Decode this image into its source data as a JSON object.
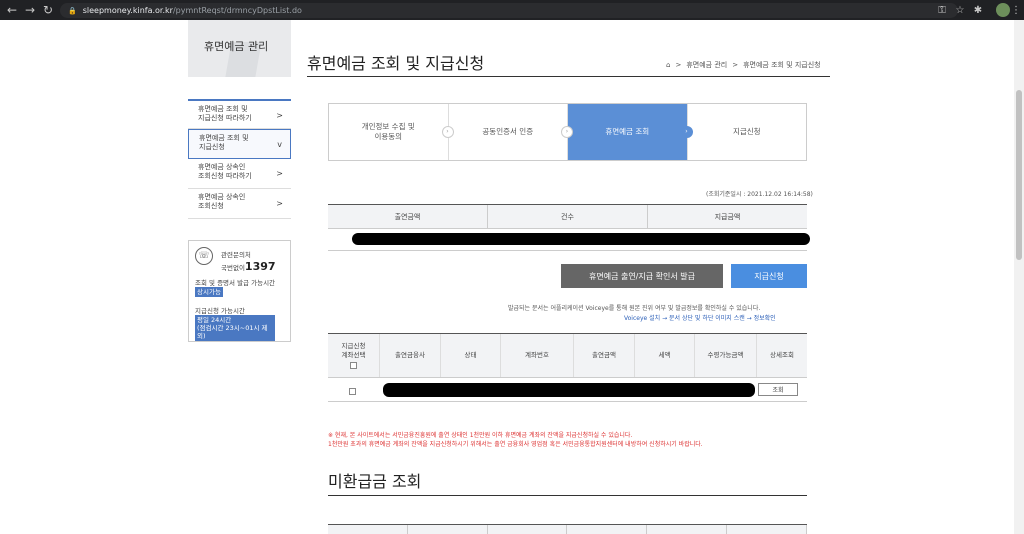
{
  "browser": {
    "url_host": "sleepmoney.kinfa.or.kr",
    "url_path": "/pymntReqst/drmncyDpstList.do"
  },
  "sidebar": {
    "title": "휴면예금 관리",
    "items": [
      {
        "line1": "휴면예금 조회 및",
        "line2": "지급신청 따라하기",
        "arrow": ">"
      },
      {
        "line1": "휴면예금 조회 및",
        "line2": "지급신청",
        "arrow": "v"
      },
      {
        "line1": "휴면예금 상속인",
        "line2": "조회신청 따라하기",
        "arrow": ">"
      },
      {
        "line1": "휴면예금 상속인",
        "line2": "조회신청",
        "arrow": ">"
      }
    ],
    "contact": {
      "label": "관련문의처",
      "number_prefix": "국번없이",
      "number": "1397",
      "hours_label": "조회 및 증명서 발급 가능시간",
      "hours_badge": "상시가능",
      "apply_label": "지급신청 가능시간",
      "apply_badge1": "평일 24시간",
      "apply_badge2": "(점검시간 23시~01시 제외)"
    }
  },
  "main": {
    "title": "휴면예금 조회 및 지급신청",
    "breadcrumb": [
      ">",
      "휴면예금 관리",
      ">",
      "휴면예금 조회 및 지급신청"
    ],
    "steps": [
      {
        "line1": "개인정보 수집 및",
        "line2": "이용동의"
      },
      {
        "line1": "공동인증서 인증",
        "line2": ""
      },
      {
        "line1": "휴면예금 조회",
        "line2": ""
      },
      {
        "line1": "지급신청",
        "line2": ""
      }
    ],
    "active_step": 2,
    "timestamp": "(조회기준일시 : 2021.12.02 16:14:58)",
    "summary_headers": [
      "출연금액",
      "건수",
      "지급금액"
    ],
    "buttons": {
      "issue": "휴면예금 출연/지급 확인서 발급",
      "apply": "지급신청"
    },
    "notice": "발급되는 문서는 어플리케이션 Voiceye를 통해 원본 진위 여부 및 발급정보를 확인하실 수 있습니다.",
    "voiceye": "Voiceye 설치 → 문서 상단 및 하단 이미지 스캔 → 정보확인",
    "account_headers": [
      "지급신청\n계좌선택",
      "출연금융사",
      "상태",
      "계좌번호",
      "출연금액",
      "세액",
      "수령가능금액",
      "상세조회"
    ],
    "view_label": "조회",
    "warning1": "※ 현재, 본 사이트에서는 서민금융진흥원에 출연 상태인 1천만원 이하 휴면예금 계좌의 잔액을 지급신청하실 수 있습니다.",
    "warning2": "1천만원 초과의 휴면예금 계좌의 잔액을 지급신청하시기 위해서는 출연 금융회사 영업점 혹은 서민금융통합지원센터에 내방하여 신청하시기 바랍니다.",
    "section2_title": "미환급금 조회"
  },
  "colors": {
    "accent": "#4a78c2",
    "step_active": "#5b8fd6",
    "button_blue": "#4a8ee0",
    "button_gray": "#666666",
    "warning": "#dd3333"
  }
}
